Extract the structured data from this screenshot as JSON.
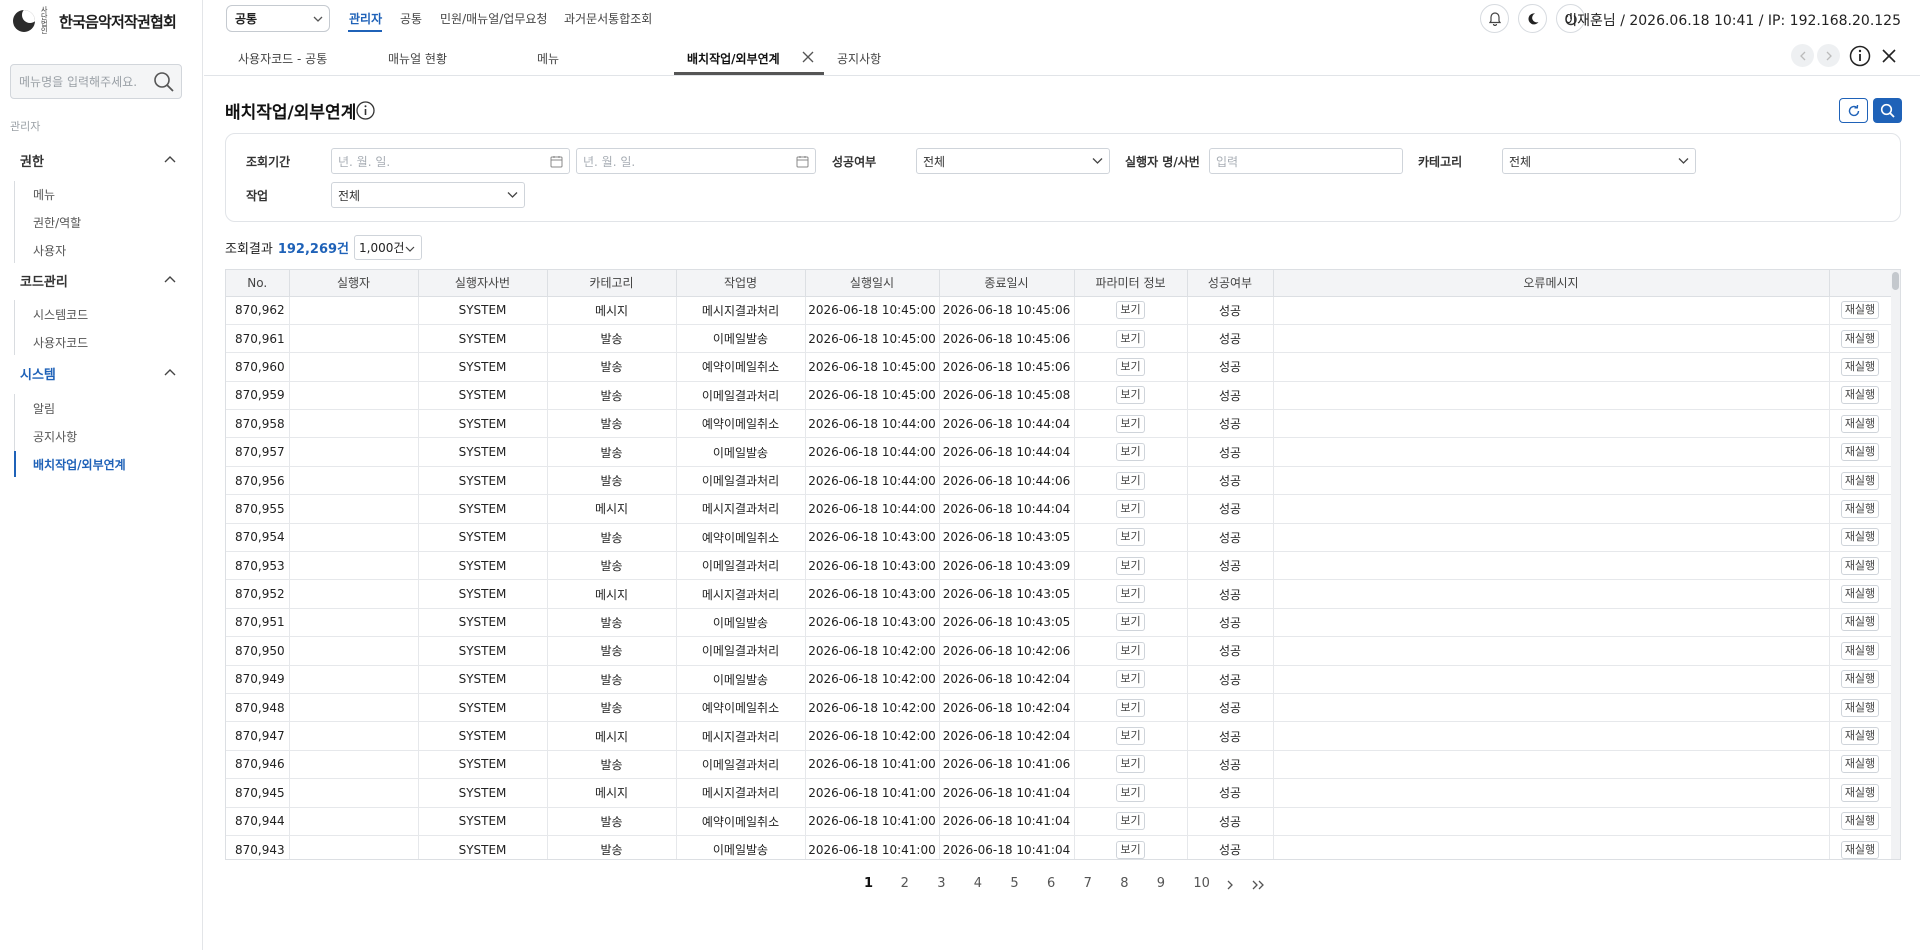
{
  "sidebar": {
    "logo_small": "사단 법인",
    "logo_text": "한국음악저작권협회",
    "search_placeholder": "메뉴명을 입력해주세요.",
    "section_label": "관리자",
    "groups": [
      {
        "label": "권한",
        "items": [
          "메뉴",
          "권한/역할",
          "사용자"
        ]
      },
      {
        "label": "코드관리",
        "items": [
          "시스템코드",
          "사용자코드"
        ]
      },
      {
        "label": "시스템",
        "items": [
          "알림",
          "공지사항",
          "배치작업/외부연계"
        ]
      }
    ]
  },
  "topnav": {
    "select_value": "공통",
    "items": [
      "관리자",
      "공통",
      "민원/매뉴얼/업무요청",
      "과거문서통합조회"
    ],
    "user_info": "이재훈님 / 2026.06.18 10:41 / IP: 192.168.20.125"
  },
  "tabs": [
    "사용자코드 - 공통",
    "매뉴얼 현황",
    "메뉴",
    "배치작업/외부연계",
    "공지사항"
  ],
  "page": {
    "title": "배치작업/외부연계"
  },
  "filters": {
    "period_label": "조회기간",
    "date_from_placeholder": "년. 월. 일.",
    "date_to_placeholder": "년. 월. 일.",
    "success_label": "성공여부",
    "success_value": "전체",
    "executor_label": "실행자 명/사번",
    "executor_placeholder": "입력",
    "category_label": "카테고리",
    "category_value": "전체",
    "job_label": "작업",
    "job_value": "전체"
  },
  "result": {
    "label": "조회결과",
    "count": "192,269건",
    "page_size": "1,000건"
  },
  "table": {
    "columns": [
      "No.",
      "실행자",
      "실행자사번",
      "카테고리",
      "작업명",
      "실행일시",
      "종료일시",
      "파라미터 정보",
      "성공여부",
      "오류메시지",
      ""
    ],
    "view_label": "보기",
    "rerun_label": "재실행",
    "rows": [
      {
        "no": "870,962",
        "executor": "",
        "emp": "SYSTEM",
        "cat": "메시지",
        "job": "메시지결과처리",
        "start": "2026-06-18 10:45:00",
        "end": "2026-06-18 10:45:06",
        "result": "성공",
        "error": ""
      },
      {
        "no": "870,961",
        "executor": "",
        "emp": "SYSTEM",
        "cat": "발송",
        "job": "이메일발송",
        "start": "2026-06-18 10:45:00",
        "end": "2026-06-18 10:45:06",
        "result": "성공",
        "error": ""
      },
      {
        "no": "870,960",
        "executor": "",
        "emp": "SYSTEM",
        "cat": "발송",
        "job": "예약이메일취소",
        "start": "2026-06-18 10:45:00",
        "end": "2026-06-18 10:45:06",
        "result": "성공",
        "error": ""
      },
      {
        "no": "870,959",
        "executor": "",
        "emp": "SYSTEM",
        "cat": "발송",
        "job": "이메일결과처리",
        "start": "2026-06-18 10:45:00",
        "end": "2026-06-18 10:45:08",
        "result": "성공",
        "error": ""
      },
      {
        "no": "870,958",
        "executor": "",
        "emp": "SYSTEM",
        "cat": "발송",
        "job": "예약이메일취소",
        "start": "2026-06-18 10:44:00",
        "end": "2026-06-18 10:44:04",
        "result": "성공",
        "error": ""
      },
      {
        "no": "870,957",
        "executor": "",
        "emp": "SYSTEM",
        "cat": "발송",
        "job": "이메일발송",
        "start": "2026-06-18 10:44:00",
        "end": "2026-06-18 10:44:04",
        "result": "성공",
        "error": ""
      },
      {
        "no": "870,956",
        "executor": "",
        "emp": "SYSTEM",
        "cat": "발송",
        "job": "이메일결과처리",
        "start": "2026-06-18 10:44:00",
        "end": "2026-06-18 10:44:06",
        "result": "성공",
        "error": ""
      },
      {
        "no": "870,955",
        "executor": "",
        "emp": "SYSTEM",
        "cat": "메시지",
        "job": "메시지결과처리",
        "start": "2026-06-18 10:44:00",
        "end": "2026-06-18 10:44:04",
        "result": "성공",
        "error": ""
      },
      {
        "no": "870,954",
        "executor": "",
        "emp": "SYSTEM",
        "cat": "발송",
        "job": "예약이메일취소",
        "start": "2026-06-18 10:43:00",
        "end": "2026-06-18 10:43:05",
        "result": "성공",
        "error": ""
      },
      {
        "no": "870,953",
        "executor": "",
        "emp": "SYSTEM",
        "cat": "발송",
        "job": "이메일결과처리",
        "start": "2026-06-18 10:43:00",
        "end": "2026-06-18 10:43:09",
        "result": "성공",
        "error": ""
      },
      {
        "no": "870,952",
        "executor": "",
        "emp": "SYSTEM",
        "cat": "메시지",
        "job": "메시지결과처리",
        "start": "2026-06-18 10:43:00",
        "end": "2026-06-18 10:43:05",
        "result": "성공",
        "error": ""
      },
      {
        "no": "870,951",
        "executor": "",
        "emp": "SYSTEM",
        "cat": "발송",
        "job": "이메일발송",
        "start": "2026-06-18 10:43:00",
        "end": "2026-06-18 10:43:05",
        "result": "성공",
        "error": ""
      },
      {
        "no": "870,950",
        "executor": "",
        "emp": "SYSTEM",
        "cat": "발송",
        "job": "이메일결과처리",
        "start": "2026-06-18 10:42:00",
        "end": "2026-06-18 10:42:06",
        "result": "성공",
        "error": ""
      },
      {
        "no": "870,949",
        "executor": "",
        "emp": "SYSTEM",
        "cat": "발송",
        "job": "이메일발송",
        "start": "2026-06-18 10:42:00",
        "end": "2026-06-18 10:42:04",
        "result": "성공",
        "error": ""
      },
      {
        "no": "870,948",
        "executor": "",
        "emp": "SYSTEM",
        "cat": "발송",
        "job": "예약이메일취소",
        "start": "2026-06-18 10:42:00",
        "end": "2026-06-18 10:42:04",
        "result": "성공",
        "error": ""
      },
      {
        "no": "870,947",
        "executor": "",
        "emp": "SYSTEM",
        "cat": "메시지",
        "job": "메시지결과처리",
        "start": "2026-06-18 10:42:00",
        "end": "2026-06-18 10:42:04",
        "result": "성공",
        "error": ""
      },
      {
        "no": "870,946",
        "executor": "",
        "emp": "SYSTEM",
        "cat": "발송",
        "job": "이메일결과처리",
        "start": "2026-06-18 10:41:00",
        "end": "2026-06-18 10:41:06",
        "result": "성공",
        "error": ""
      },
      {
        "no": "870,945",
        "executor": "",
        "emp": "SYSTEM",
        "cat": "메시지",
        "job": "메시지결과처리",
        "start": "2026-06-18 10:41:00",
        "end": "2026-06-18 10:41:04",
        "result": "성공",
        "error": ""
      },
      {
        "no": "870,944",
        "executor": "",
        "emp": "SYSTEM",
        "cat": "발송",
        "job": "예약이메일취소",
        "start": "2026-06-18 10:41:00",
        "end": "2026-06-18 10:41:04",
        "result": "성공",
        "error": ""
      },
      {
        "no": "870,943",
        "executor": "",
        "emp": "SYSTEM",
        "cat": "발송",
        "job": "이메일발송",
        "start": "2026-06-18 10:41:00",
        "end": "2026-06-18 10:41:04",
        "result": "성공",
        "error": ""
      }
    ]
  },
  "pagination": {
    "pages": [
      "1",
      "2",
      "3",
      "4",
      "5",
      "6",
      "7",
      "8",
      "9",
      "10"
    ],
    "current": "1"
  },
  "colors": {
    "accent": "#1f62b8"
  }
}
